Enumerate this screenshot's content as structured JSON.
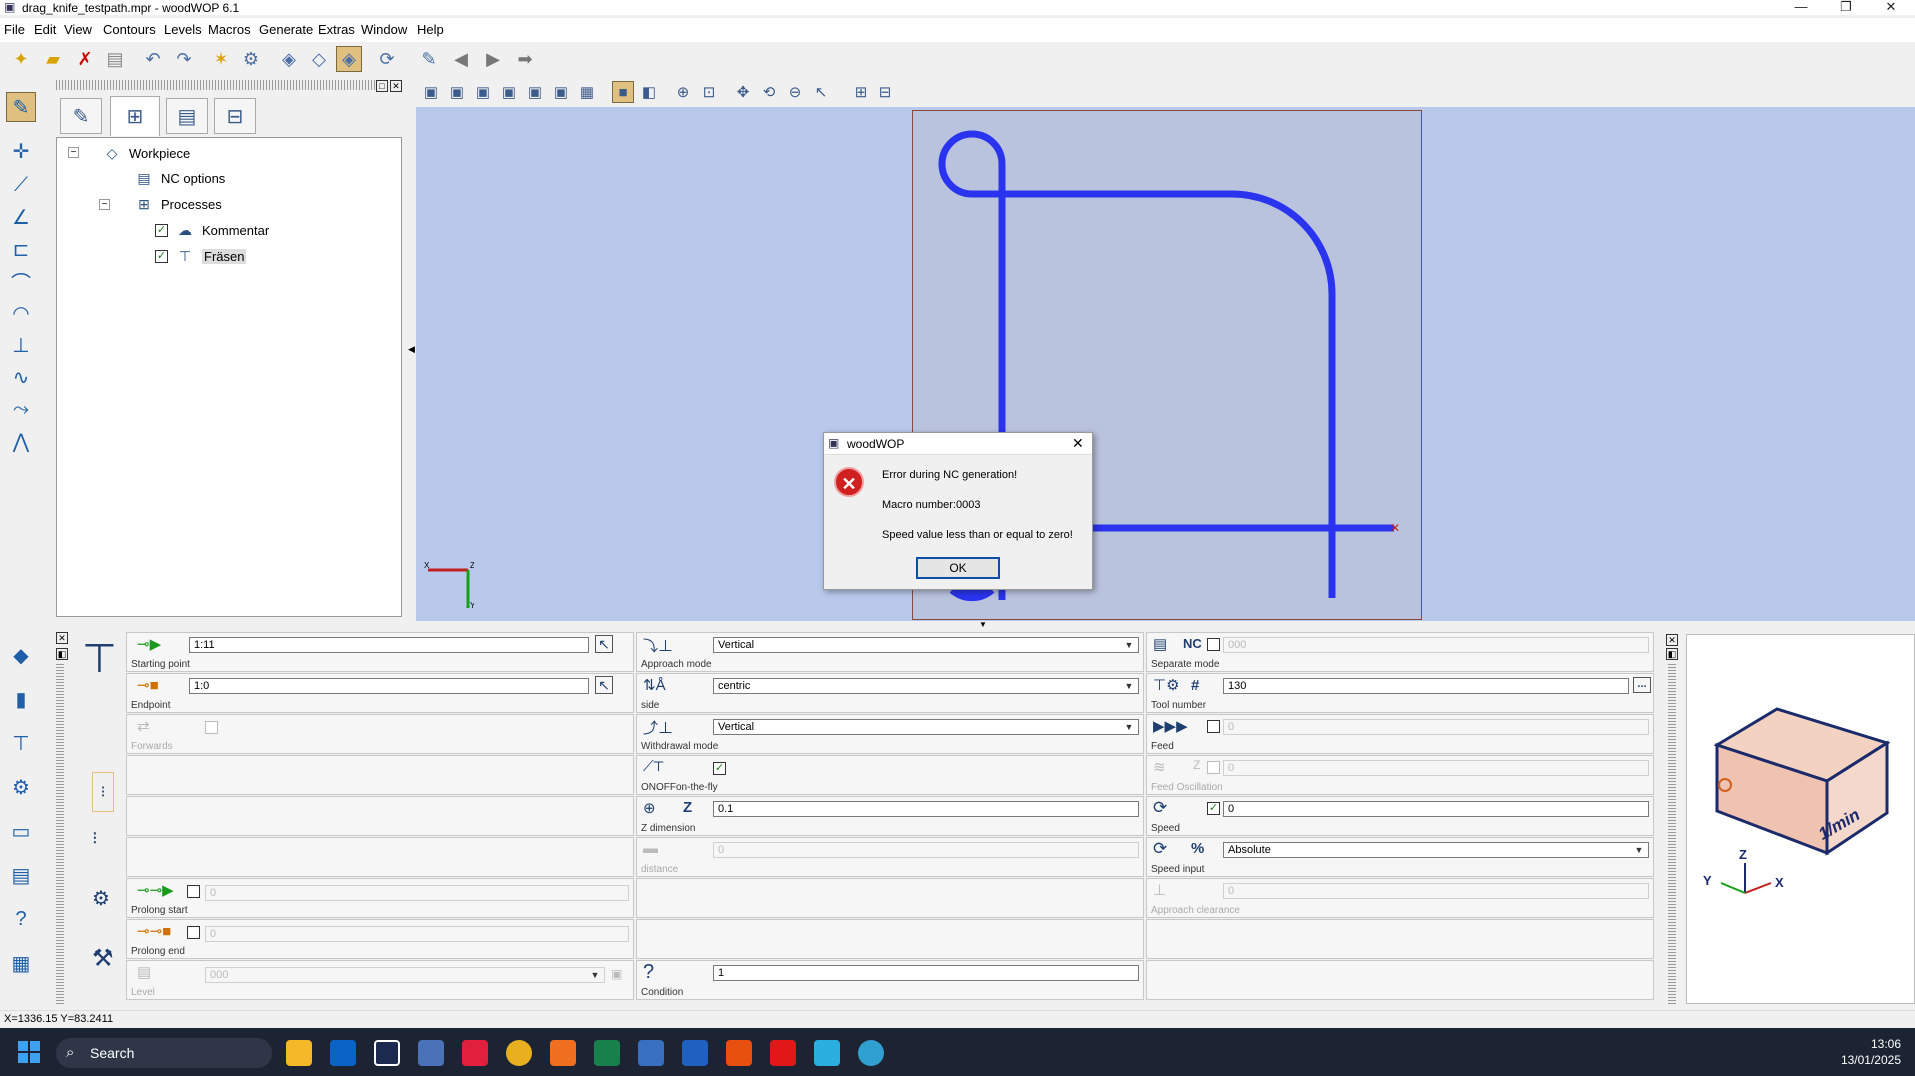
{
  "window": {
    "title": "drag_knife_testpath.mpr - woodWOP 6.1",
    "minimize": "—",
    "maximize": "❐",
    "close": "✕"
  },
  "menu": [
    "File",
    "Edit",
    "View",
    "Contours",
    "Levels",
    "Macros",
    "Generate",
    "Extras",
    "Window",
    "Help"
  ],
  "tree": {
    "workpiece": "Workpiece",
    "nc_options": "NC options",
    "processes": "Processes",
    "kommentar": "Kommentar",
    "fraesen": "Fräsen"
  },
  "dialog": {
    "title": "woodWOP",
    "line1": "Error during NC generation!",
    "line2": "Macro number:0003",
    "line3": "Speed value less than or equal to zero!",
    "ok": "OK"
  },
  "axes": {
    "x": "X",
    "y": "Y",
    "z": "Z"
  },
  "props": {
    "starting_point": {
      "label": "Starting point",
      "value": "1:11"
    },
    "endpoint": {
      "label": "Endpoint",
      "value": "1:0"
    },
    "forwards": {
      "label": "Forwards"
    },
    "prolong_start": {
      "label": "Prolong start",
      "value": "0"
    },
    "prolong_end": {
      "label": "Prolong end",
      "value": "0"
    },
    "level": {
      "label": "Level",
      "value": "000"
    },
    "approach_mode": {
      "label": "Approach mode",
      "value": "Vertical"
    },
    "side": {
      "label": "side",
      "value": "centric"
    },
    "withdrawal_mode": {
      "label": "Withdrawal mode",
      "value": "Vertical"
    },
    "onoff": {
      "label": "ONOFFon-the-fly"
    },
    "z_dimension": {
      "label": "Z dimension",
      "value": "0.1",
      "z": "Z"
    },
    "distance": {
      "label": "distance",
      "value": "0"
    },
    "condition": {
      "label": "Condition",
      "value": "1"
    },
    "separate_mode": {
      "label": "Separate mode",
      "value": "000",
      "nc": "NC"
    },
    "tool_number": {
      "label": "Tool number",
      "value": "130",
      "hash": "#",
      "more": "..."
    },
    "feed": {
      "label": "Feed",
      "value": "0"
    },
    "feed_oscillation": {
      "label": "Feed Oscillation",
      "value": "0",
      "z": "Z"
    },
    "speed": {
      "label": "Speed",
      "value": "0"
    },
    "speed_input": {
      "label": "Speed input",
      "value": "Absolute",
      "pct": "%"
    },
    "approach_clearance": {
      "label": "Approach clearance",
      "value": "0"
    }
  },
  "preview": {
    "unit": "1/min"
  },
  "status": {
    "coords": "X=1336.15 Y=83.2411"
  },
  "taskbar": {
    "search": "Search",
    "time": "13:06",
    "date": "13/01/2025"
  }
}
